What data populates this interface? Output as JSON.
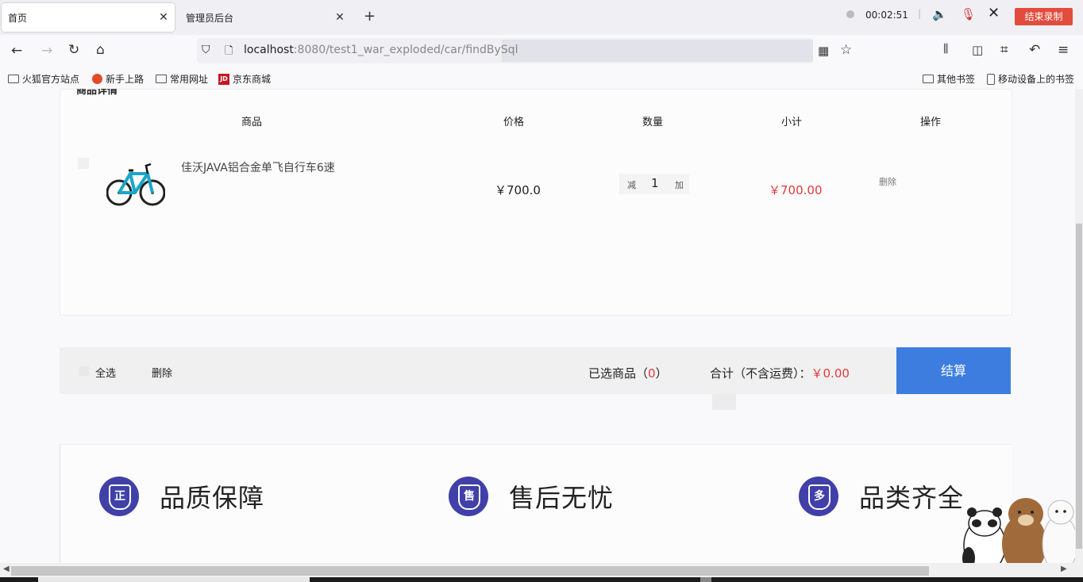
{
  "browser": {
    "tabs": [
      {
        "label": "首页",
        "active": true
      },
      {
        "label": "管理员后台",
        "active": false
      }
    ],
    "url_host": "localhost",
    "url_rest": ":8080/test1_war_exploded/car/findBySql"
  },
  "recorder": {
    "time": "00:02:51",
    "stop_label": "结束录制"
  },
  "bookmarks": [
    "火狐官方站点",
    "新手上路",
    "常用网址",
    "京东商城"
  ],
  "bookmarks_right": [
    "其他书签",
    "移动设备上的书签"
  ],
  "cart": {
    "section_title": "商品详情",
    "headers": [
      "商品",
      "价格",
      "数量",
      "小计",
      "操作"
    ],
    "item": {
      "name": "佳沃JAVA铝合金单飞自行车6速",
      "price": "￥700.0",
      "qty_minus": "减",
      "qty": "1",
      "qty_plus": "加",
      "subtotal": "￥700.00",
      "delete": "删除"
    },
    "footer": {
      "select_all": "全选",
      "delete": "删除",
      "selected_prefix": "已选商品（",
      "selected_count": "0",
      "selected_suffix": "）",
      "total_label": "合计（不含运费）：",
      "total_value": "￥0.00",
      "checkout": "结算"
    }
  },
  "guarantees": [
    {
      "icon": "正",
      "text": "品质保障"
    },
    {
      "icon": "售",
      "text": "售后无忧"
    },
    {
      "icon": "多",
      "text": "品类齐全"
    }
  ]
}
